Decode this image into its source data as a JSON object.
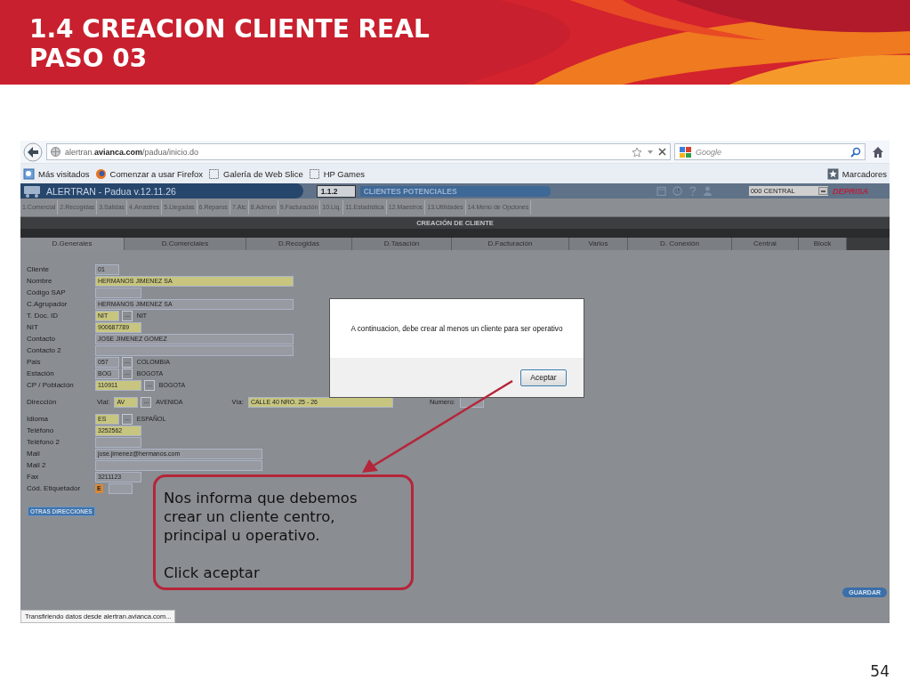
{
  "slide": {
    "title_lines": [
      "1.4 CREACION CLIENTE REAL",
      "PASO 03"
    ],
    "page_number": "54"
  },
  "browser": {
    "url": "alertran.**avianca.com**/padua/inicio.do",
    "search_placeholder": "Google",
    "bookmarks": [
      {
        "label": "Más visitados",
        "kind": "folder"
      },
      {
        "label": "Comenzar a usar Firefox",
        "kind": "firefox"
      },
      {
        "label": "Galería de Web Slice",
        "kind": "slice"
      },
      {
        "label": "HP Games",
        "kind": "slice"
      }
    ],
    "bookmarks_menu": "Marcadores",
    "status_bar": "Transfiriendo datos desde alertran.avianca.com..."
  },
  "app": {
    "title": "ALERTRAN - Padua  v.12.11.26",
    "screen_code": "1.1.2",
    "screen_name": "CLIENTES POTENCIALES",
    "office": "000 CENTRAL",
    "logo": "DEPRISA"
  },
  "menu": [
    "1.Comercial",
    "2.Recogidas",
    "3.Salidas",
    "4.Arrastres",
    "5.Llegadas",
    "6.Reparos",
    "7.Atc",
    "8.Admon",
    "9.Facturación",
    "10.Liq.",
    "11.Estadística",
    "12.Maestros",
    "13.Utilidades",
    "14.Menú de Opciones"
  ],
  "section_title": "CREACIÓN DE CLIENTE",
  "tabs": [
    {
      "label": "D.Generales",
      "selected": true
    },
    {
      "label": "D.Comerciales",
      "selected": false
    },
    {
      "label": "D.Recogidas",
      "selected": false
    },
    {
      "label": "D.Tasación",
      "selected": false
    },
    {
      "label": "D.Facturación",
      "selected": false
    },
    {
      "label": "Varios",
      "selected": false
    },
    {
      "label": "D. Conexión",
      "selected": false
    },
    {
      "label": "Central",
      "selected": false
    },
    {
      "label": "Block",
      "selected": false
    }
  ],
  "form_rows": [
    {
      "label": "Cliente",
      "kind": "field",
      "parts": [
        {
          "kind": "code",
          "value": "01",
          "highlighted": false
        }
      ]
    },
    {
      "label": "Nombre",
      "kind": "field",
      "parts": [
        {
          "kind": "wide",
          "value": "HERMANOS JIMENEZ SA",
          "highlighted": true
        }
      ]
    },
    {
      "label": "Código SAP",
      "kind": "field",
      "parts": [
        {
          "kind": "number",
          "highlighted": false
        }
      ]
    },
    {
      "label": "C.Agrupador",
      "kind": "field",
      "parts": [
        {
          "kind": "wide",
          "value": "HERMANOS JIMENEZ SA",
          "highlighted": false
        }
      ]
    },
    {
      "label": "T. Doc. ID",
      "kind": "field",
      "parts": [
        {
          "kind": "code",
          "value": "NIT",
          "highlighted": true
        },
        {
          "kind": "lookup",
          "text": "..."
        },
        {
          "kind": "text",
          "text": "NIT"
        }
      ]
    },
    {
      "label": "NIT",
      "kind": "field",
      "parts": [
        {
          "kind": "number",
          "value": "900687789",
          "highlighted": true
        }
      ]
    },
    {
      "label": "Contacto",
      "kind": "field",
      "parts": [
        {
          "kind": "wide",
          "value": "JOSE JIMENEZ GOMEZ",
          "highlighted": false
        }
      ]
    },
    {
      "label": "Contacto 2",
      "kind": "field",
      "parts": [
        {
          "kind": "wide",
          "highlighted": false
        }
      ]
    },
    {
      "label": "Pais",
      "kind": "field",
      "parts": [
        {
          "kind": "code",
          "value": "057",
          "highlighted": false
        },
        {
          "kind": "lookup",
          "text": "..."
        },
        {
          "kind": "text",
          "text": "COLOMBIA"
        }
      ]
    },
    {
      "label": "Estación",
      "kind": "field",
      "parts": [
        {
          "kind": "code",
          "value": "BOG",
          "highlighted": false
        },
        {
          "kind": "lookup",
          "text": "..."
        },
        {
          "kind": "text",
          "text": "BOGOTA"
        }
      ]
    },
    {
      "label": "CP / Población",
      "kind": "field",
      "parts": [
        {
          "kind": "number",
          "value": "110911",
          "highlighted": true
        },
        {
          "kind": "lookup",
          "text": "..."
        },
        {
          "kind": "text",
          "text": "BOGOTA"
        }
      ]
    },
    {
      "label": "Dirección",
      "kind": "address",
      "parts": [
        {
          "kind": "caption",
          "text": "Vial:"
        },
        {
          "kind": "code",
          "value": "AV",
          "highlighted": true
        },
        {
          "kind": "lookup",
          "text": "..."
        },
        {
          "kind": "text",
          "text": "AVENIDA"
        },
        {
          "kind": "caption",
          "text": "Vía:"
        },
        {
          "kind": "street",
          "value": "CALLE 40 NRO. 25 - 26",
          "highlighted": true
        },
        {
          "kind": "caption",
          "text": "Numero:"
        },
        {
          "kind": "code",
          "highlighted": false
        }
      ]
    },
    {
      "label": "Idioma",
      "kind": "field",
      "parts": [
        {
          "kind": "code",
          "value": "ES",
          "highlighted": true
        },
        {
          "kind": "lookup",
          "text": "..."
        },
        {
          "kind": "text",
          "text": "ESPAÑOL"
        }
      ]
    },
    {
      "label": "Teléfono",
      "kind": "field",
      "parts": [
        {
          "kind": "number",
          "value": "3252562",
          "highlighted": true
        }
      ]
    },
    {
      "label": "Teléfono 2",
      "kind": "field",
      "parts": [
        {
          "kind": "number",
          "highlighted": false
        }
      ]
    },
    {
      "label": "Mail",
      "kind": "field",
      "parts": [
        {
          "kind": "medium",
          "value": "jose.jimenez@hermanos.com",
          "highlighted": false
        }
      ]
    },
    {
      "label": "Mail 2",
      "kind": "field",
      "parts": [
        {
          "kind": "medium",
          "highlighted": false
        }
      ]
    },
    {
      "label": "Fax",
      "kind": "field",
      "parts": [
        {
          "kind": "number",
          "value": "3211123",
          "highlighted": false
        }
      ]
    },
    {
      "label": "Cód. Etiquetador",
      "kind": "field",
      "parts": [
        {
          "kind": "tag",
          "text": "E"
        },
        {
          "kind": "code",
          "highlighted": false
        }
      ]
    }
  ],
  "other_addresses_button": "OTRAS DIRECCIONES",
  "save_button": "GUARDAR",
  "dialog": {
    "message": "A continuacion, debe crear al menos un cliente para ser operativo",
    "button": "Aceptar"
  },
  "callout": {
    "paragraphs": [
      "Nos informa que debemos crear un cliente centro, principal u operativo.",
      "Click aceptar"
    ]
  }
}
